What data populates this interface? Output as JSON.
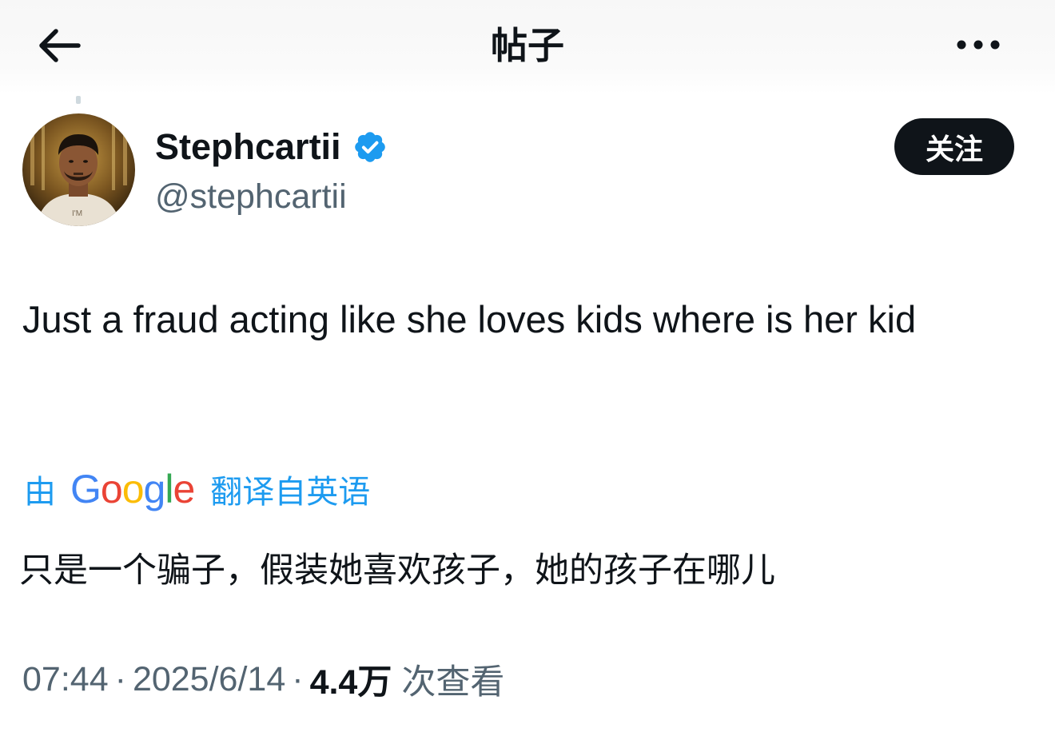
{
  "header": {
    "title": "帖子",
    "back_icon": "arrow-left-icon",
    "more_icon": "more-horizontal-icon"
  },
  "author": {
    "display_name": "Stephcartii",
    "handle": "@stephcartii",
    "verified_icon": "verified-badge-icon",
    "verified_color": "#1d9bf0",
    "avatar_shirt_text": "I'M"
  },
  "follow_button": {
    "label": "关注"
  },
  "tweet": {
    "text": "Just a fraud acting like she loves kids where is her kid"
  },
  "translation": {
    "by_label": "由",
    "provider_letters": [
      "G",
      "o",
      "o",
      "g",
      "l",
      "e"
    ],
    "provider_colors": [
      "#4285f4",
      "#ea4335",
      "#fbbc05",
      "#4285f4",
      "#34a853",
      "#ea4335"
    ],
    "label": "翻译自英语",
    "text": "只是一个骗子，假装她喜欢孩子，她的孩子在哪儿"
  },
  "meta": {
    "time": "07:44",
    "separator": "·",
    "date": "2025/6/14",
    "views_count": "4.4万",
    "views_label": "次查看"
  },
  "colors": {
    "text_primary": "#0f1419",
    "text_secondary": "#536471",
    "accent": "#1d9bf0",
    "button_bg": "#0f1419"
  }
}
